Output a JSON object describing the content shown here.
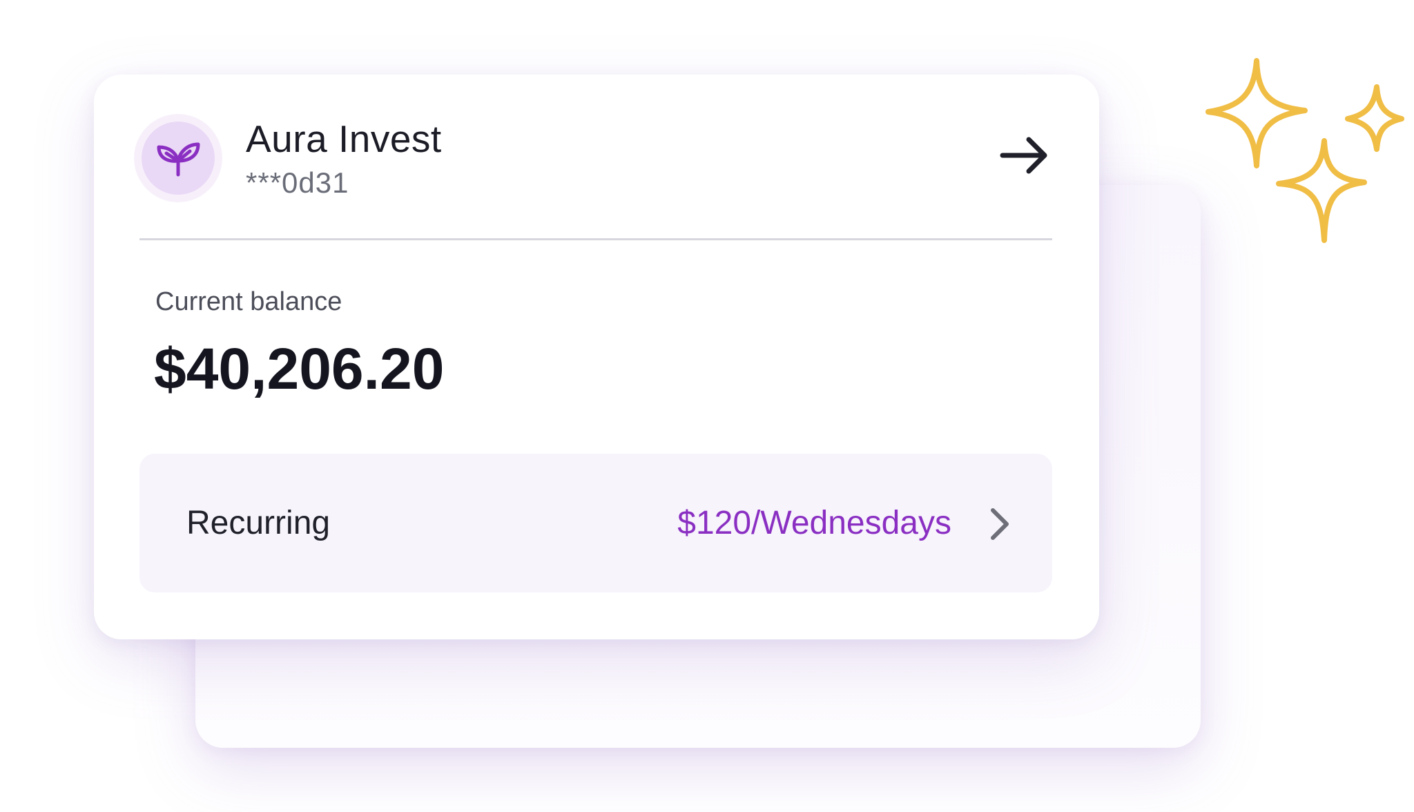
{
  "account": {
    "name": "Aura Invest",
    "number": "***0d31",
    "icon": "sprout-icon"
  },
  "balance": {
    "label": "Current balance",
    "value": "$40,206.20"
  },
  "recurring": {
    "label": "Recurring",
    "value": "$120/Wednesdays"
  },
  "colors": {
    "accent": "#8a2fc2",
    "sparkle": "#f0bd45",
    "row_background": "#f7f4fc",
    "icon_background": "#ead9f6"
  }
}
